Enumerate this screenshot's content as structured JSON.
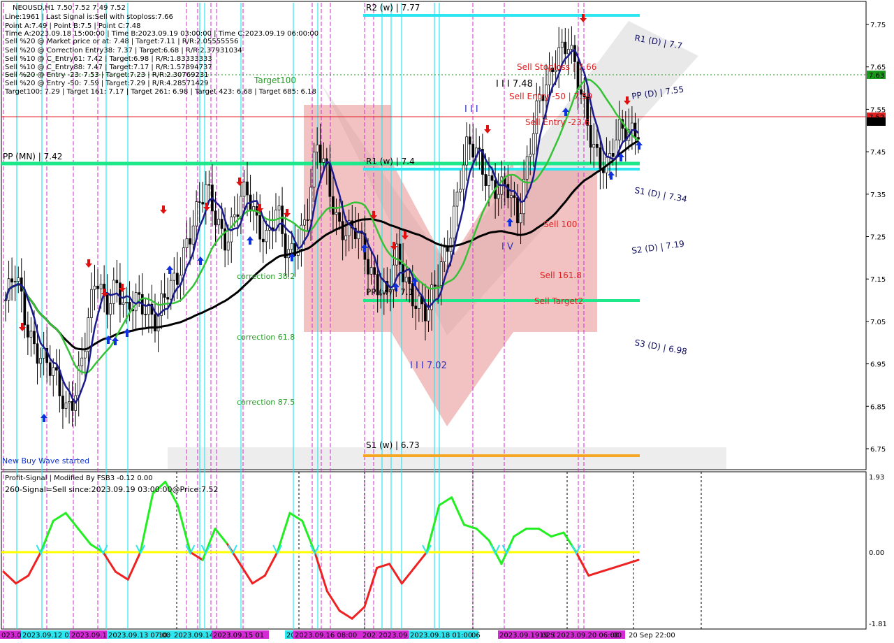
{
  "header": {
    "symbol_line": "NEOUSD,H1  7.50 7.52 7.49 7.52",
    "info_lines": [
      "Line:1961 | Last Signal is:Sell with stoploss:7.66",
      "Point A:7.49 | Point B:7.5 | Point C:7.48",
      "Time A:2023.09.18 15:00:00 | Time B:2023.09.19 03:00:00 | Time C:2023.09.19 06:00:00",
      "Sell %20 @ Market price or at: 7.48 | Target:7.11 | R/R:2.05555556",
      "Sell %20 @ Correction Entry38: 7.37 | Target:6.68 | R/R:2.37931034",
      "Sell %10 @ C_Entry61: 7.42 | Target:6.98 | R/R:1.83333333",
      "Sell %10 @ C_Entry88: 7.47 | Target:7.17 | R/R:1.57894737",
      "Sell %20 @ Entry -23: 7.53 | Target:7.23 | R/R:2.30769231",
      "Sell %20 @ Entry -50: 7.59 | Target:7.29 | R/R:4.28571429",
      "Target100: 7.29 | Target 161: 7.17 | Target 261: 6.98 | Target 423: 6.68 | Target 685: 6.18"
    ]
  },
  "colors": {
    "blue_ma": "#1a1a8c",
    "green_ma": "#36c236",
    "black_ma": "#000000",
    "cyan": "#2ee6f0",
    "green_level": "#1ee88a",
    "orange": "#f5a623",
    "magenta": "#d42ad4",
    "red_zone": "#e89090",
    "osc_up": "#22ee22",
    "osc_down": "#ee2222",
    "zero_line": "#ffff00"
  },
  "levels": {
    "r2w": "R2 (w) | 7.77",
    "r1w": "R1 (w) | 7.4",
    "ppw": "PP (w) | 7.1",
    "s1w": "S1 (w) | 6.73",
    "ppmn": "PP (MN) | 7.42",
    "r1d": "R1 (D) | 7.7",
    "ppd": "PP (D) | 7.55",
    "s1d": "S1 (D) | 7.34",
    "s2d": "S2 (D) | 7.19",
    "s3d": "S3 (D) | 6.98"
  },
  "annotations": {
    "target100": "Target100",
    "correction38": "correction 38.2",
    "correction61": "correction 61.8",
    "correction87": "correction 87.5",
    "sell_stoploss": "Sell Stoploss | 7.66",
    "sell_entry50": "Sell Entry -50 | 7.59",
    "sell_entry23": "Sell Entry -23.6",
    "sell100": "Sell 100",
    "sell161": "Sell 161.8",
    "sell_target2": "Sell Target2",
    "wave_high": "I I I 7.48",
    "wave_low": "I I I 7.02",
    "wave_top": "I I I",
    "wave_iv": "I V",
    "buy_wave": "New Buy Wave started"
  },
  "price_axis": {
    "ticks": [
      "7.75",
      "7.65",
      "7.55",
      "7.45",
      "7.35",
      "7.25",
      "7.15",
      "7.05",
      "6.95",
      "6.85",
      "6.75"
    ],
    "tag_green": "7.63",
    "tag_red": "7.52",
    "tag_black": "7.52"
  },
  "oscillator": {
    "title": "Profit-Signal | Modified By FSB3 -0.12 0.00",
    "signal_text": "260-Signal=Sell since:2023.09.19 03:00:00@Price:7.52",
    "ticks": [
      "1.93",
      "0.00",
      "-1.81"
    ]
  },
  "time_axis": {
    "labels": [
      "023.09",
      "2023.09.12 02:0",
      "2023.09.1",
      "2023.09.13 07:00",
      "10:",
      "2023.09.14",
      "2023.09.15 01",
      "2023.09.",
      "2023.09.16 08:00",
      "2023",
      "2023.09.1",
      "2023.09.18 01:00",
      "06",
      "2023.09.19 02:00",
      "19 Se",
      "2023.09.20 06:00",
      ":00",
      "20 Sep 22:00"
    ]
  },
  "chart_data": {
    "type": "candlestick",
    "symbol": "NEOUSD",
    "timeframe": "H1",
    "ylim": [
      6.7,
      7.81
    ],
    "x_range": [
      "2023.09.11",
      "2023.09.20 22:00"
    ],
    "pivot_levels": [
      {
        "name": "R2 (w)",
        "value": 7.77
      },
      {
        "name": "R1 (w)",
        "value": 7.4
      },
      {
        "name": "PP (w)",
        "value": 7.1
      },
      {
        "name": "S1 (w)",
        "value": 6.73
      },
      {
        "name": "PP (MN)",
        "value": 7.42
      },
      {
        "name": "R1 (D)",
        "value": 7.7
      },
      {
        "name": "PP (D)",
        "value": 7.55
      },
      {
        "name": "S1 (D)",
        "value": 7.34
      },
      {
        "name": "S2 (D)",
        "value": 7.19
      },
      {
        "name": "S3 (D)",
        "value": 6.98
      }
    ],
    "close_path": [
      7.1,
      7.15,
      7.05,
      7.0,
      6.95,
      6.9,
      6.85,
      6.9,
      7.0,
      7.15,
      7.1,
      7.15,
      7.05,
      7.1,
      7.1,
      7.05,
      7.1,
      7.15,
      7.25,
      7.3,
      7.35,
      7.3,
      7.25,
      7.3,
      7.35,
      7.3,
      7.25,
      7.3,
      7.2,
      7.25,
      7.3,
      7.45,
      7.4,
      7.3,
      7.25,
      7.25,
      7.2,
      7.15,
      7.1,
      7.2,
      7.15,
      7.1,
      7.05,
      7.15,
      7.25,
      7.35,
      7.45,
      7.45,
      7.4,
      7.35,
      7.35,
      7.3,
      7.45,
      7.55,
      7.6,
      7.7,
      7.72,
      7.6,
      7.5,
      7.45,
      7.42,
      7.48,
      7.5,
      7.52
    ],
    "osc_path": [
      -0.5,
      -0.8,
      -0.6,
      0.0,
      0.8,
      1.0,
      0.6,
      0.2,
      0.0,
      -0.5,
      -0.7,
      0.0,
      1.5,
      1.8,
      1.2,
      0.0,
      -0.2,
      0.6,
      0.2,
      -0.3,
      -0.8,
      -0.6,
      0.0,
      1.0,
      0.8,
      0.0,
      -1.0,
      -1.5,
      -1.7,
      -1.4,
      -0.4,
      -0.3,
      -0.8,
      -0.4,
      0.0,
      1.2,
      1.4,
      0.7,
      0.6,
      0.3,
      -0.3,
      0.4,
      0.6,
      0.6,
      0.4,
      0.5,
      0.0,
      -0.6,
      -0.5,
      -0.4,
      -0.3,
      -0.2
    ]
  }
}
